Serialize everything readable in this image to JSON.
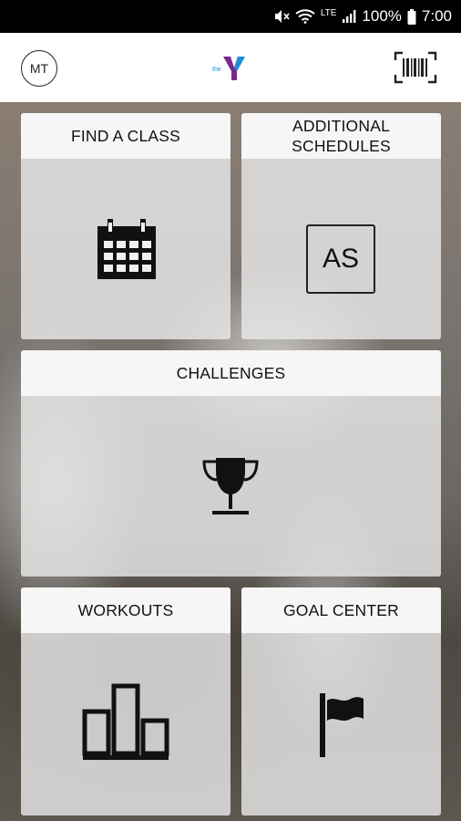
{
  "status_bar": {
    "network": "LTE",
    "battery": "100%",
    "time": "7:00"
  },
  "header": {
    "avatar_initials": "MT",
    "logo_text": "the"
  },
  "tiles": {
    "find_class": {
      "title": "FIND A CLASS"
    },
    "additional_schedules": {
      "title": "ADDITIONAL\nSCHEDULES",
      "badge": "AS"
    },
    "challenges": {
      "title": "CHALLENGES"
    },
    "workouts": {
      "title": "WORKOUTS"
    },
    "goal_center": {
      "title": "GOAL CENTER"
    }
  },
  "colors": {
    "logo_purple": "#7a2a8a",
    "logo_blue": "#1f8fd6",
    "status_bar_bg": "#000000"
  }
}
